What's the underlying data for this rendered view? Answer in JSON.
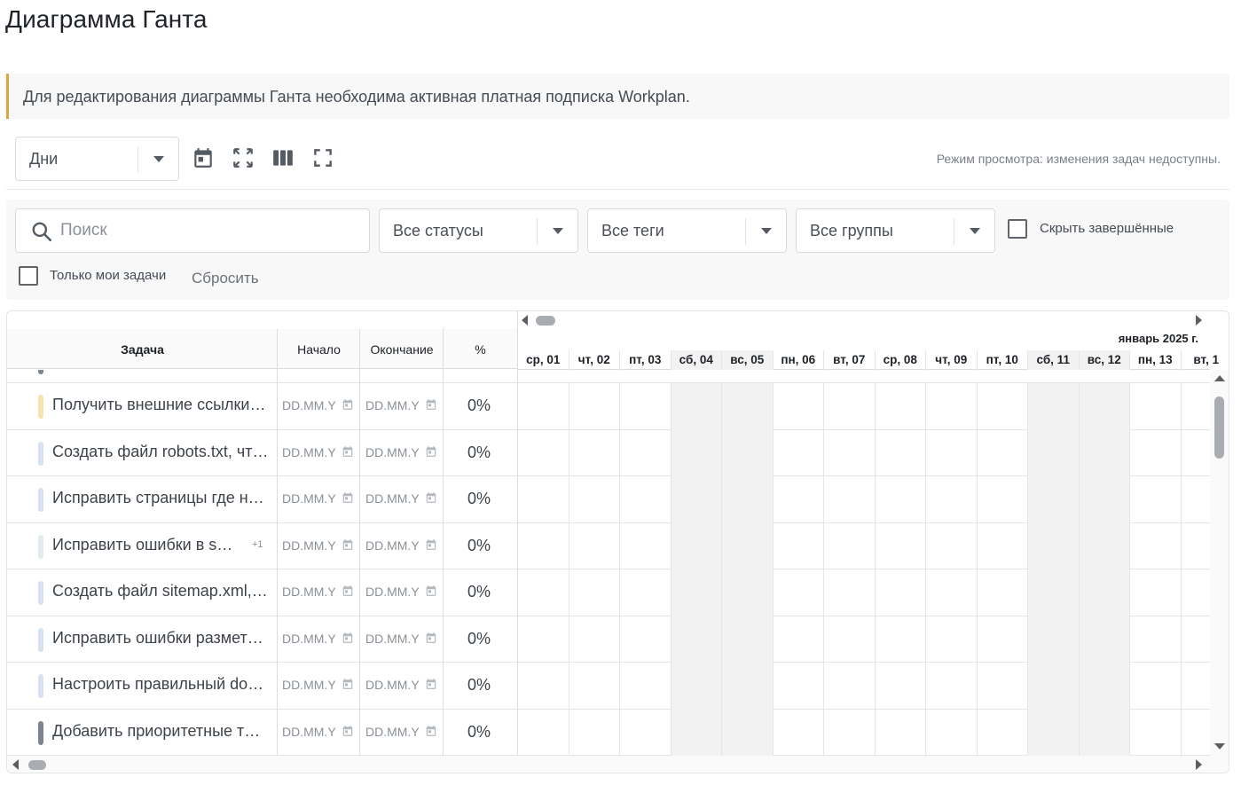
{
  "page": {
    "title": "Диаграмма Ганта"
  },
  "alert": {
    "text": "Для редактирования диаграммы Ганта необходима активная платная подписка Workplan.",
    "accent_color": "#e0a43a"
  },
  "toolbar": {
    "view_select_value": "Дни",
    "icons": [
      "calendar-icon",
      "expand-icon",
      "columns-icon",
      "fullscreen-icon"
    ],
    "mode_note": "Режим просмотра: изменения задач недоступны."
  },
  "filters": {
    "search_placeholder": "Поиск",
    "status_value": "Все статусы",
    "tags_value": "Все теги",
    "groups_value": "Все группы",
    "hide_completed_label": "Скрыть завершённые",
    "only_my_tasks_label": "Только мои задачи",
    "reset_label": "Сбросить"
  },
  "grid": {
    "columns": {
      "task": "Задача",
      "start": "Начало",
      "end": "Окончание",
      "percent": "%"
    },
    "month": "январь 2025 г.",
    "days": [
      {
        "label": "ср, 01",
        "weekend": false
      },
      {
        "label": "чт, 02",
        "weekend": false
      },
      {
        "label": "пт, 03",
        "weekend": false
      },
      {
        "label": "сб, 04",
        "weekend": true
      },
      {
        "label": "вс, 05",
        "weekend": true
      },
      {
        "label": "пн, 06",
        "weekend": false
      },
      {
        "label": "вт, 07",
        "weekend": false
      },
      {
        "label": "ср, 08",
        "weekend": false
      },
      {
        "label": "чт, 09",
        "weekend": false
      },
      {
        "label": "пт, 10",
        "weekend": false
      },
      {
        "label": "сб, 11",
        "weekend": true
      },
      {
        "label": "вс, 12",
        "weekend": true
      },
      {
        "label": "пн, 13",
        "weekend": false
      },
      {
        "label": "вт, 1",
        "weekend": false
      }
    ],
    "tasks": [
      {
        "name": "Получить внешние ссылки…",
        "start": "DD.MM.Y",
        "end": "DD.MM.Y",
        "percent": "0%",
        "color": "#f7e3b0",
        "more": ""
      },
      {
        "name": "Создать файл robots.txt, чт…",
        "start": "DD.MM.Y",
        "end": "DD.MM.Y",
        "percent": "0%",
        "color": "#d6e2ee",
        "more": ""
      },
      {
        "name": "Исправить страницы где н…",
        "start": "DD.MM.Y",
        "end": "DD.MM.Y",
        "percent": "0%",
        "color": "#d6e2ee",
        "more": ""
      },
      {
        "name": "Исправить ошибки в s…",
        "start": "DD.MM.Y",
        "end": "DD.MM.Y",
        "percent": "0%",
        "color": "#e2ecef",
        "more": "+1"
      },
      {
        "name": "Создать файл sitemap.xml,…",
        "start": "DD.MM.Y",
        "end": "DD.MM.Y",
        "percent": "0%",
        "color": "#d6e2ee",
        "more": ""
      },
      {
        "name": "Исправить ошибки размет…",
        "start": "DD.MM.Y",
        "end": "DD.MM.Y",
        "percent": "0%",
        "color": "#d6e2ee",
        "more": ""
      },
      {
        "name": "Настроить правильный do…",
        "start": "DD.MM.Y",
        "end": "DD.MM.Y",
        "percent": "0%",
        "color": "#d6e2ee",
        "more": ""
      },
      {
        "name": "Добавить приоритетные т…",
        "start": "DD.MM.Y",
        "end": "DD.MM.Y",
        "percent": "0%",
        "color": "#7d8590",
        "more": ""
      }
    ]
  }
}
